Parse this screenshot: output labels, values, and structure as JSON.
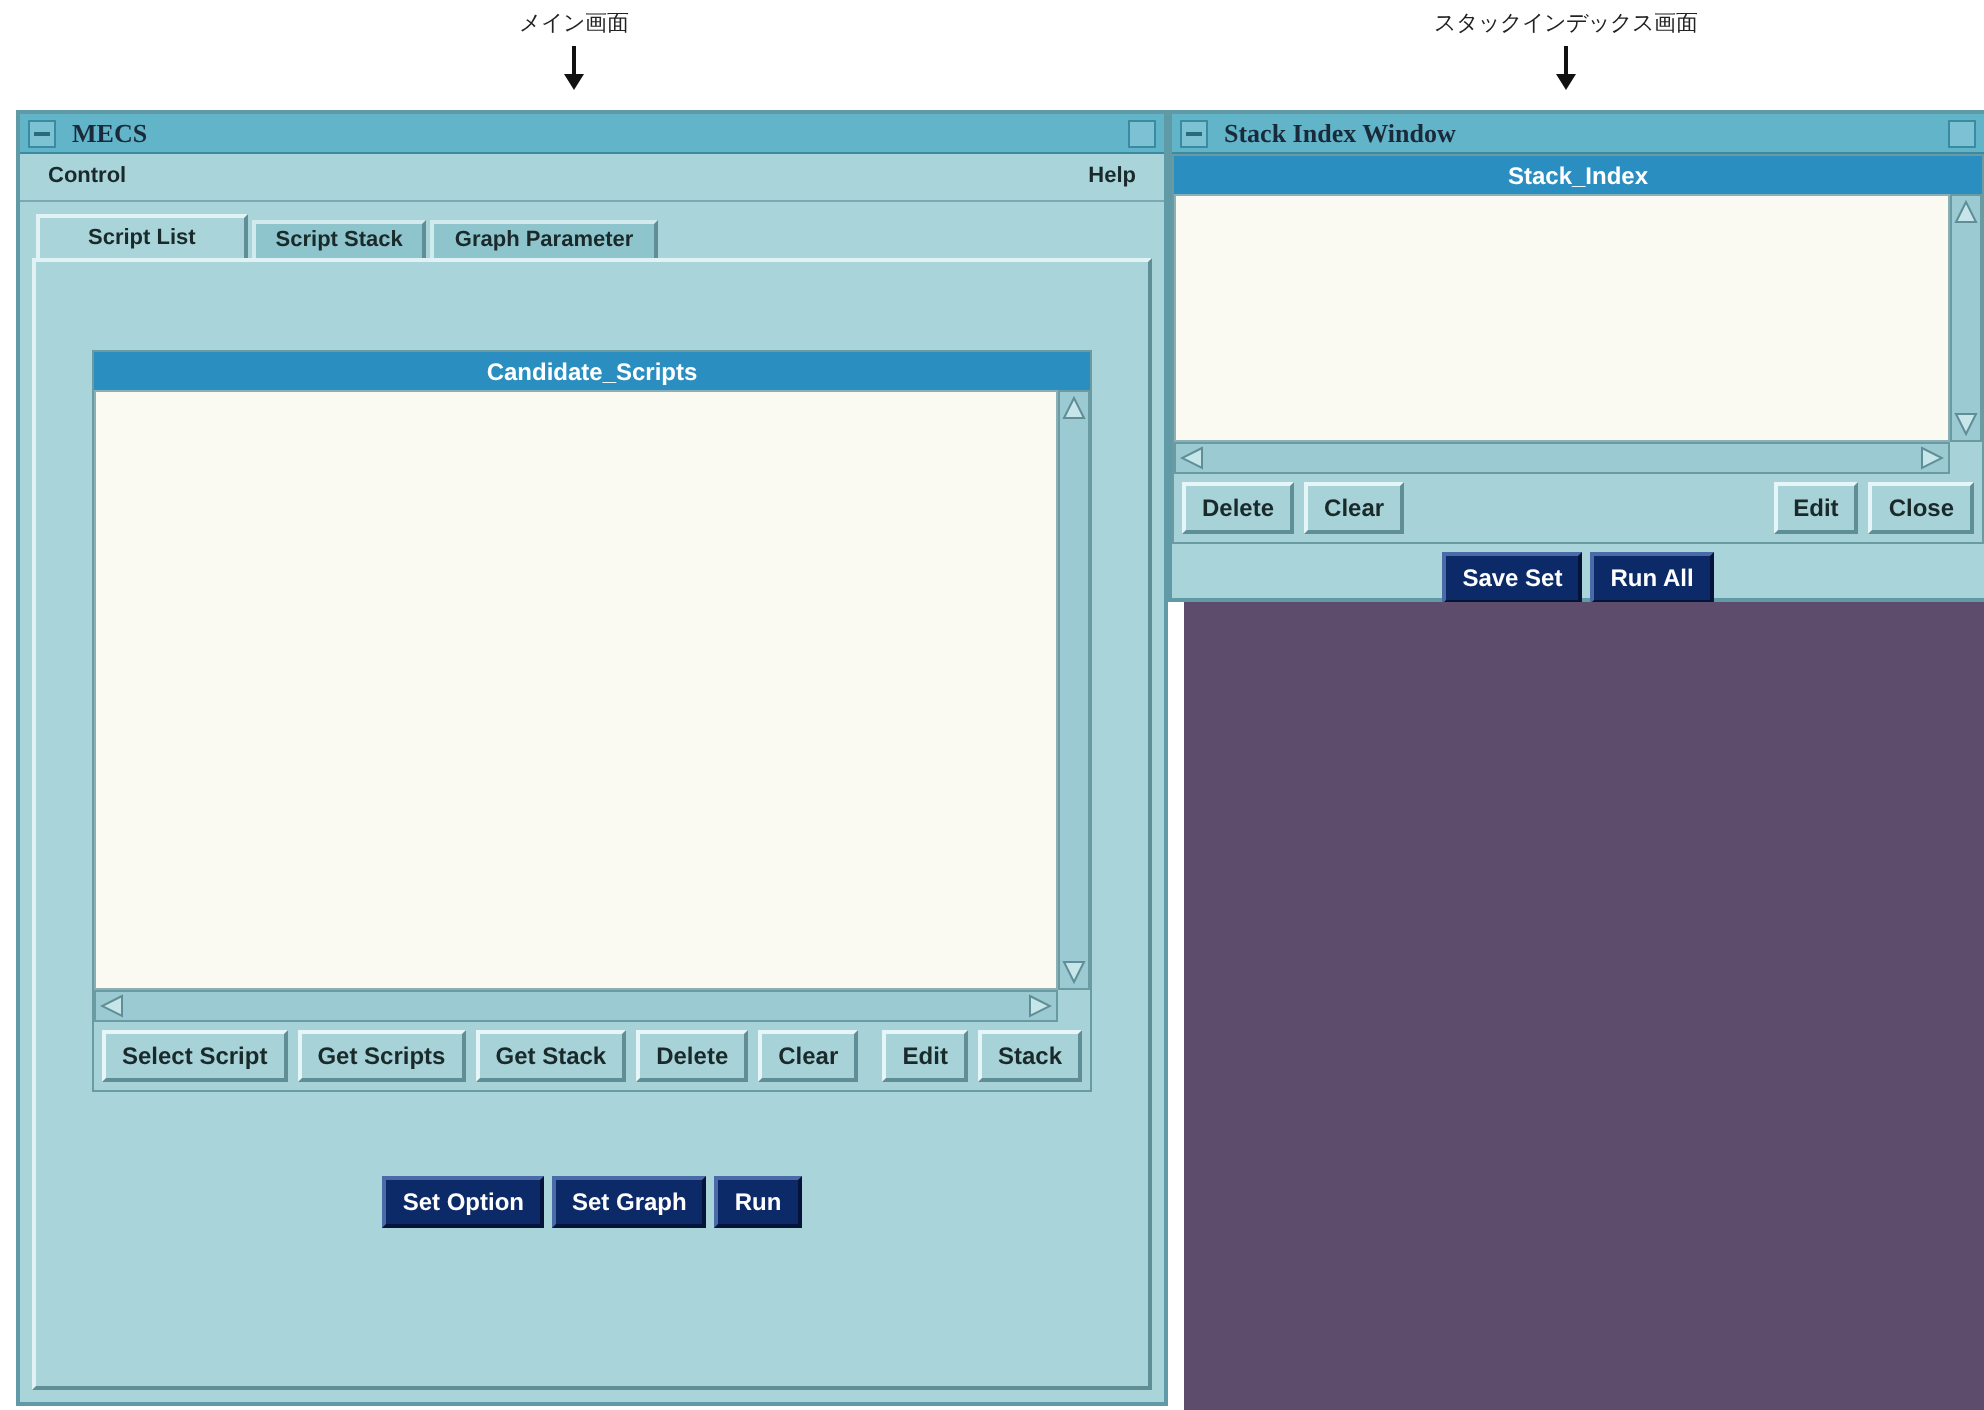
{
  "annotations": [
    {
      "label": "メイン画面"
    },
    {
      "label": "スタックインデックス画面"
    }
  ],
  "main_window": {
    "title": "MECS",
    "menu_left": "Control",
    "menu_right": "Help",
    "tabs": [
      {
        "label": "Script List",
        "selected": true
      },
      {
        "label": "Script Stack",
        "selected": false
      },
      {
        "label": "Graph Parameter",
        "selected": false
      }
    ],
    "list": {
      "title": "Candidate_Scripts",
      "left_buttons": [
        "Select Script",
        "Get Scripts",
        "Get Stack",
        "Delete",
        "Clear"
      ],
      "right_buttons": [
        "Edit",
        "Stack"
      ]
    },
    "actions": [
      "Set Option",
      "Set Graph",
      "Run"
    ]
  },
  "stack_window": {
    "title": "Stack Index Window",
    "list": {
      "title": "Stack_Index",
      "left_buttons": [
        "Delete",
        "Clear"
      ],
      "right_buttons": [
        "Edit",
        "Close"
      ]
    },
    "actions": [
      "Save Set",
      "Run All"
    ]
  }
}
